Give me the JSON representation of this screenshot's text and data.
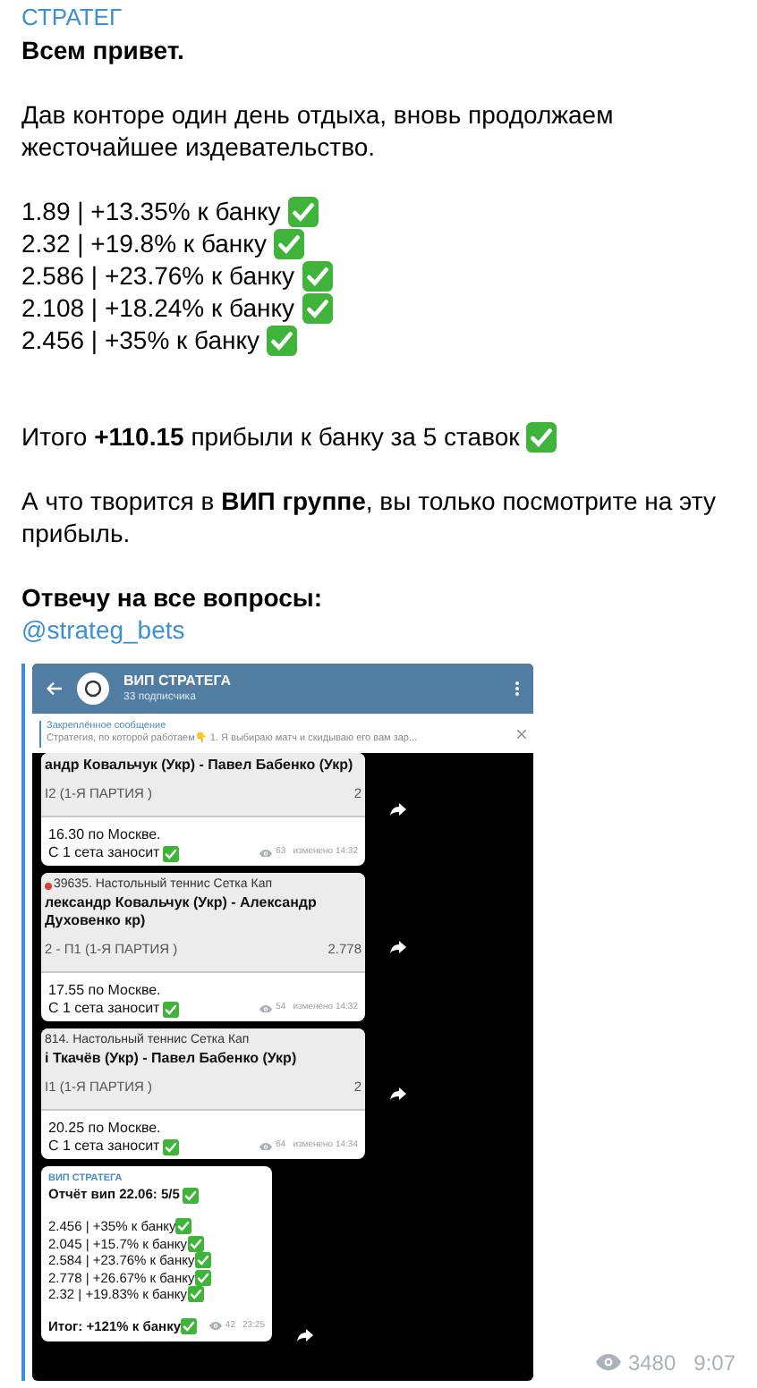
{
  "post": {
    "channel": "СТРАТЕГ",
    "greeting": "Всем привет.",
    "intro": "Дав конторе один день отдыха, вновь продолжаем жесточайшее издевательство.",
    "results": [
      {
        "text": "1.89 | +13.35% к банку",
        "checked": true
      },
      {
        "text": "2.32 | +19.8% к банку",
        "checked": true
      },
      {
        "text": "2.586 | +23.76% к банку",
        "checked": true
      },
      {
        "text": "2.108 | +18.24% к банку",
        "checked": true
      },
      {
        "text": "2.456 | +35% к банку",
        "checked": true
      }
    ],
    "total": {
      "text": "Итого **+110.15** прибыли к банку за 5 ставок",
      "checked": true
    },
    "vip": "А что творится в **ВИП группе**, вы только посмотрите на эту прибыль.",
    "contact": "Отвечу на все вопросы:",
    "link": "@strateg_bets"
  },
  "screenshot": {
    "title": "ВИП СТРАТЕГА",
    "subscribers": "33 подписчика",
    "pinned_label": "Закреплённое сообщение",
    "pinned_text": "Стратегия, по которой работаем👇 1. Я выбираю матч и скидываю его вам зар...",
    "messages": [
      {
        "kind": "bet",
        "match": "андр Ковальчук (Укр) - Павел Бабенко (Укр)",
        "market": "I2 (1-Я ПАРТИЯ )",
        "odds": "2",
        "time": "16.30 по Москве.",
        "note": "С 1 сета заносит",
        "views": "63",
        "edited": "изменено 14:32"
      },
      {
        "kind": "bet",
        "header": "39635. Настольный теннис Сетка Кап",
        "match": "лександр Ковальчук (Укр) - Александр Духовенко кр)",
        "market": "2 - П1 (1-Я ПАРТИЯ )",
        "odds": "2.778",
        "time": "17.55 по Москве.",
        "note": "С 1 сета заносит",
        "views": "54",
        "edited": "изменено 14:32"
      },
      {
        "kind": "bet",
        "header": "814. Настольный теннис Сетка Кап",
        "match": "і Ткачёв (Укр) - Павел Бабенко (Укр)",
        "market": "I1 (1-Я ПАРТИЯ )",
        "odds": "2",
        "time": "20.25 по Москве.",
        "note": "С 1 сета заносит",
        "views": "64",
        "edited": "изменено 14:34"
      },
      {
        "kind": "report",
        "sender": "ВИП СТРАТЕГА",
        "title": "Отчёт вип 22.06: 5/5",
        "lines": [
          "2.456 | +35% к банку",
          "2.045 | +15.7% к банку",
          "2.584 | +23.76% к банку",
          "2.778 | +26.67% к банку",
          "2.32 | +19.83% к банку"
        ],
        "total": "Итог: +121% к банку",
        "views": "42",
        "edited": "23:25"
      }
    ]
  },
  "footer": {
    "views": "3480",
    "time": "9:07"
  }
}
